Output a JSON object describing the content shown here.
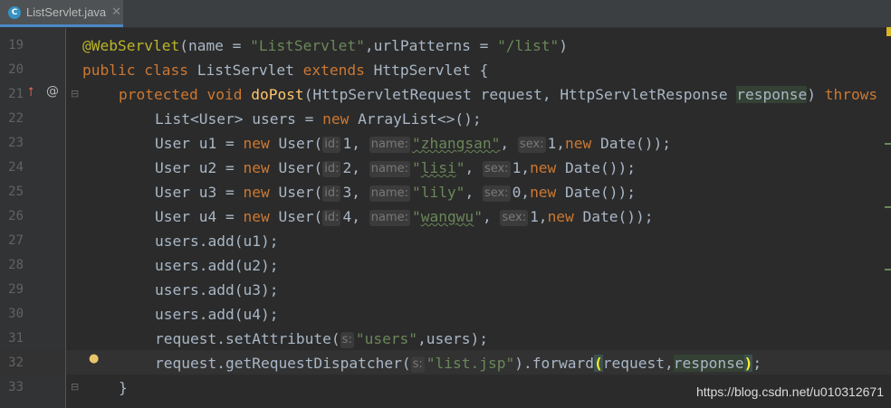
{
  "tab": {
    "icon": "C",
    "title": "ListServlet.java",
    "close": "✕"
  },
  "lines": {
    "19": "19",
    "20": "20",
    "21": "21",
    "22": "22",
    "23": "23",
    "24": "24",
    "25": "25",
    "26": "26",
    "27": "27",
    "28": "28",
    "29": "29",
    "30": "30",
    "31": "31",
    "32": "32",
    "33": "33"
  },
  "gutter_icons": {
    "override": "⭡",
    "annotation": "@",
    "bulb": "💡"
  },
  "watermark": "https://blog.csdn.net/u010312671"
}
